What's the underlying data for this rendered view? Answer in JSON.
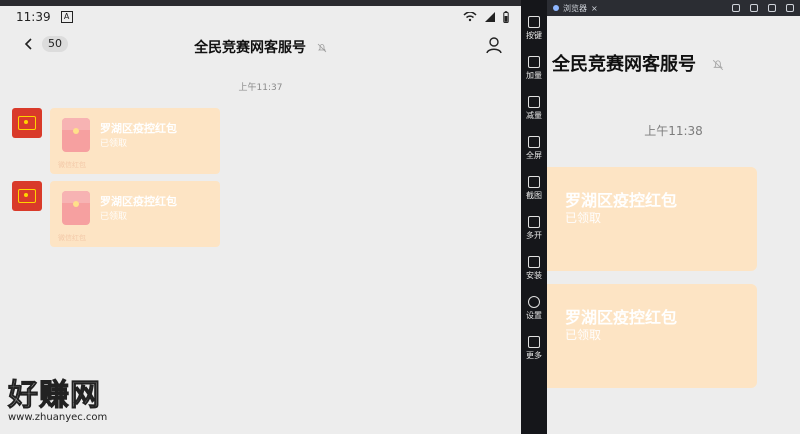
{
  "phone": {
    "status_time": "11:39",
    "status_app_glyph": "A",
    "back_badge": "50",
    "title": "全民竞赛网客服号",
    "timestamp": "上午11:37",
    "messages": [
      {
        "title": "罗湖区疫控红包",
        "status": "已领取",
        "brand": "微信红包"
      },
      {
        "title": "罗湖区疫控红包",
        "status": "已领取",
        "brand": "微信红包"
      }
    ]
  },
  "watermark": {
    "cn": "好赚网",
    "url": "www.zhuanyec.com"
  },
  "toolbar": {
    "items": [
      {
        "label": "按键",
        "icon": "keyboard-icon"
      },
      {
        "label": "加量",
        "icon": "volume-up-icon"
      },
      {
        "label": "减量",
        "icon": "volume-down-icon"
      },
      {
        "label": "全屏",
        "icon": "fullscreen-icon"
      },
      {
        "label": "截图",
        "icon": "scissors-icon"
      },
      {
        "label": "多开",
        "icon": "multi-window-icon"
      },
      {
        "label": "安装",
        "icon": "install-icon"
      },
      {
        "label": "设置",
        "icon": "gear-icon"
      },
      {
        "label": "更多",
        "icon": "more-icon"
      }
    ]
  },
  "preview": {
    "tab_label": "浏览器",
    "title": "全民竞赛网客服号",
    "timestamp": "上午11:38",
    "packets": [
      {
        "title": "罗湖区疫控红包",
        "status": "已领取"
      },
      {
        "title": "罗湖区疫控红包",
        "status": "已领取"
      }
    ]
  },
  "colors": {
    "packet_bg": "#fde4c4",
    "avatar_red": "#d93a2a",
    "toolbar_bg": "#15161a",
    "chat_bg": "#ededed"
  }
}
